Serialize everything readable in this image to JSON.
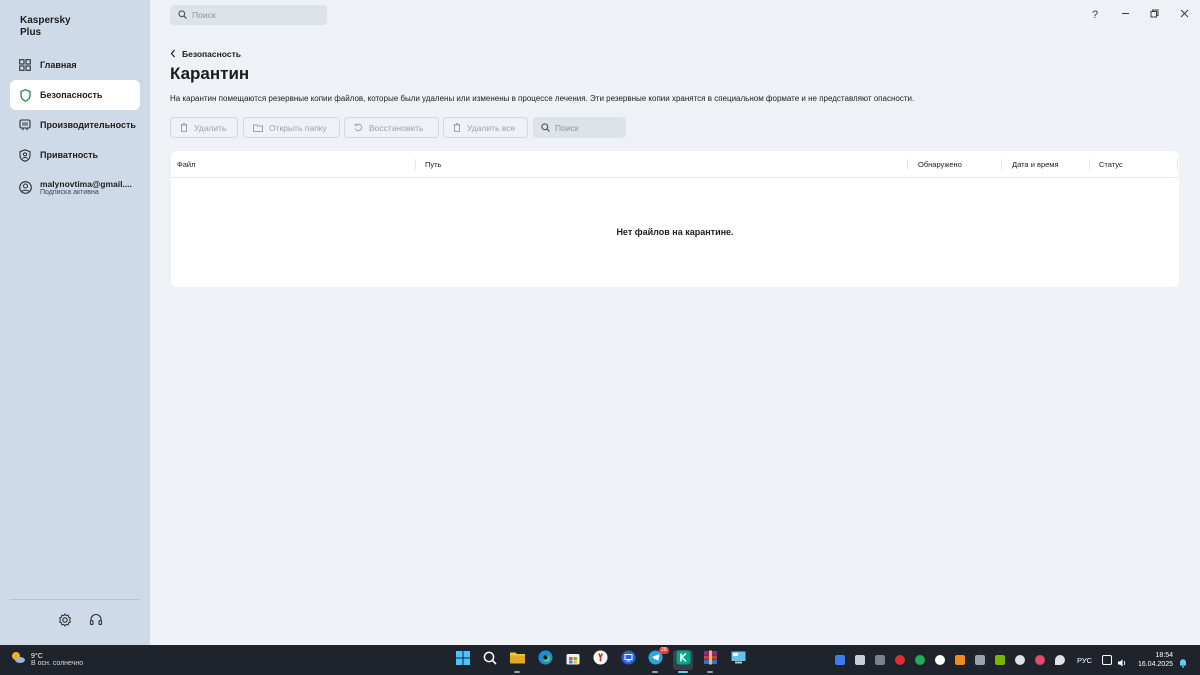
{
  "app": {
    "brand_line1": "Kaspersky",
    "brand_line2": "Plus"
  },
  "sidebar": {
    "items": [
      {
        "label": "Главная",
        "icon": "dashboard-icon",
        "active": false
      },
      {
        "label": "Безопасность",
        "icon": "shield-icon",
        "active": true
      },
      {
        "label": "Производительность",
        "icon": "speedometer-icon",
        "active": false
      },
      {
        "label": "Приватность",
        "icon": "privacy-icon",
        "active": false
      }
    ],
    "account": {
      "email": "malynovtima@gmail....",
      "subscription": "Подписка активна"
    },
    "bottom": [
      "settings-icon",
      "support-icon"
    ]
  },
  "topbar": {
    "search_placeholder": "Поиск",
    "window_controls": [
      "help-icon",
      "minimize-icon",
      "restore-icon",
      "close-icon"
    ],
    "help_glyph": "?"
  },
  "content": {
    "breadcrumb": "Безопасность",
    "title": "Карантин",
    "description": "На карантин помещаются резервные копии файлов, которые были удалены или изменены в процессе лечения. Эти резервные копии хранятся в специальном формате и не представляют опасности.",
    "toolbar": {
      "delete": "Удалить",
      "open_folder": "Открыть папку",
      "restore": "Восстановить",
      "delete_all": "Удалить все",
      "search_placeholder": "Поиск"
    },
    "table": {
      "columns": [
        "Файл",
        "Путь",
        "Обнаружено",
        "Дата и время",
        "Статус"
      ],
      "rows": [],
      "empty_message": "Нет файлов на карантине."
    }
  },
  "taskbar": {
    "weather": {
      "temp": "9°C",
      "condition": "В осн. солнечно"
    },
    "apps": [
      "start-icon",
      "search-icon",
      "file-explorer-icon",
      "edge-icon",
      "store-icon",
      "yandex-browser-icon",
      "remote-app-icon",
      "telegram-icon",
      "kaspersky-icon",
      "winrar-icon",
      "control-panel-icon"
    ],
    "telegram_badge": "28",
    "language": "РУС",
    "time": "18:54",
    "date": "16.04.2025"
  },
  "colors": {
    "sidebar_bg": "#cfdae8",
    "main_bg": "#eef1f6",
    "accent_green": "#1a8a5e",
    "taskbar_bg": "#1f232b"
  }
}
